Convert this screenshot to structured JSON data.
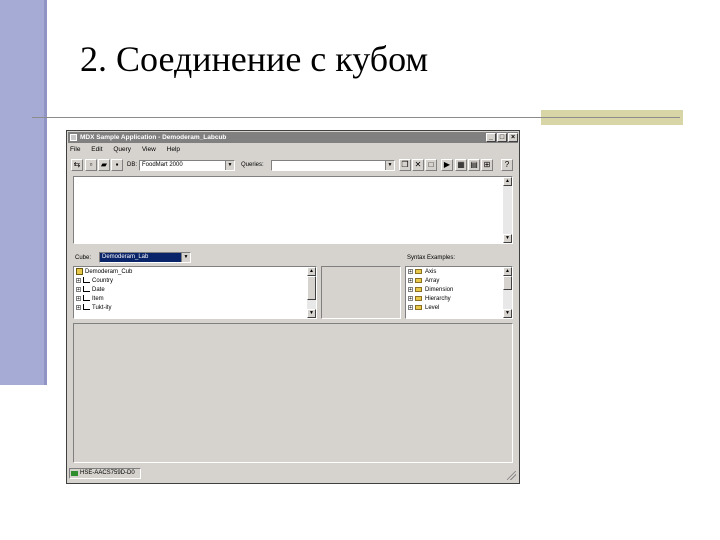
{
  "slide": {
    "title": "2. Соединение с кубом"
  },
  "window": {
    "title": "MDX Sample Application - Demoderam_Labcub",
    "controls": {
      "minimize": "_",
      "maximize": "□",
      "close": "×"
    }
  },
  "menu": [
    "File",
    "Edit",
    "Query",
    "View",
    "Help"
  ],
  "toolbar": {
    "db_label": "DB:",
    "db_value": "FoodMart 2000",
    "queries_label": "Queries:",
    "queries_value": ""
  },
  "cube": {
    "label": "Cube:",
    "value": "Demoderam_Lab"
  },
  "tree": {
    "root": "Demoderam_Cub",
    "items": [
      "Country",
      "Date",
      "Item",
      "Tukt-ity"
    ]
  },
  "syntax": {
    "label": "Syntax Examples:",
    "items": [
      "Axis",
      "Array",
      "Dimension",
      "Hierarchy",
      "Level"
    ]
  },
  "status": {
    "text": "HSE-AACS759D-D0"
  },
  "colors": {
    "side_band": "#a6abd6",
    "accent": "#d8d5a6",
    "window_face": "#d6d3ce",
    "title_bar": "#808080",
    "selection": "#0a246a"
  }
}
